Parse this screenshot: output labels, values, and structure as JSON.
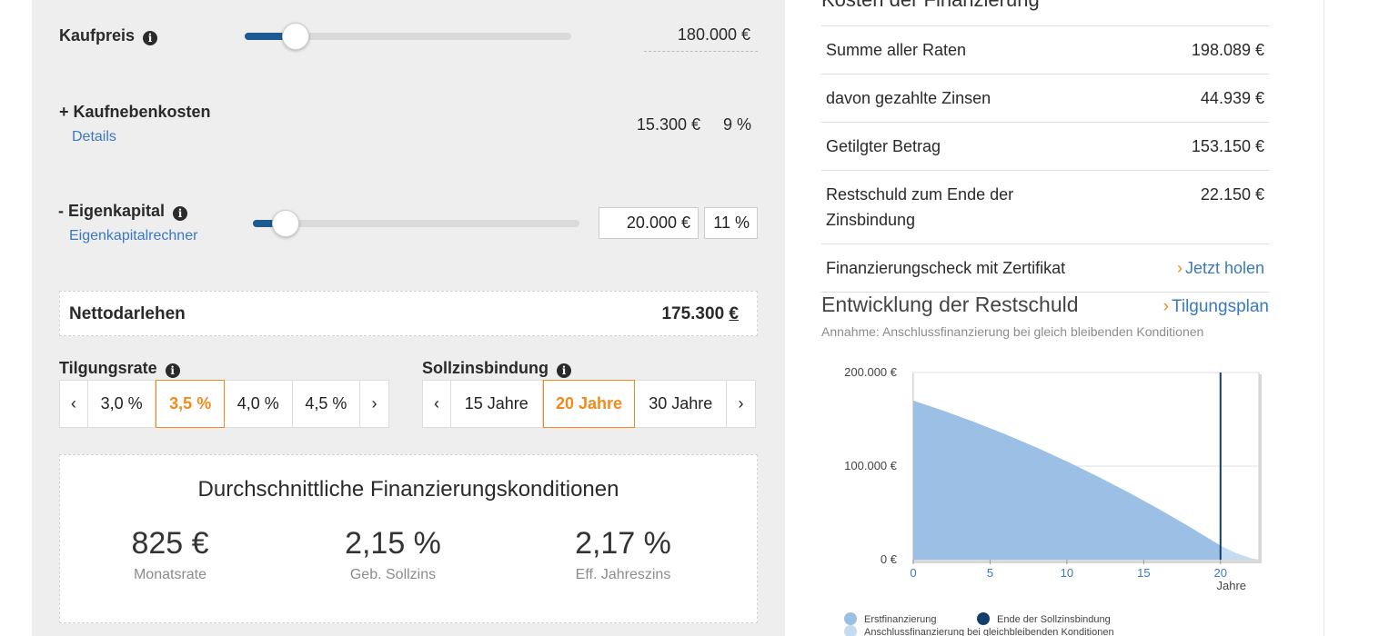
{
  "kaufpreis": {
    "label": "Kaufpreis",
    "value": "180.000 €",
    "slider_fraction": 0.155
  },
  "nebenkosten": {
    "label": "+ Kaufnebenkosten",
    "details_link": "Details",
    "amount": "15.300 €",
    "percent": "9 %"
  },
  "eigenkapital": {
    "label": "- Eigenkapital",
    "link": "Eigenkapitalrechner",
    "amount": "20.000 €",
    "percent": "11 %",
    "slider_fraction": 0.1
  },
  "netto": {
    "label": "Nettodarlehen",
    "value_num": "175.300",
    "value_unit": "€"
  },
  "tilgung": {
    "label": "Tilgungsrate",
    "prev": "‹",
    "next": "›",
    "options": [
      "3,0 %",
      "3,5 %",
      "4,0 %",
      "4,5 %"
    ],
    "selected": "3,5 %"
  },
  "sollzins": {
    "label": "Sollzinsbindung",
    "prev": "‹",
    "next": "›",
    "options": [
      "15 Jahre",
      "20 Jahre",
      "30 Jahre"
    ],
    "selected": "20 Jahre"
  },
  "conditions": {
    "title": "Durchschnittliche Finanzierungskonditionen",
    "monatsrate": {
      "value": "825 €",
      "label": "Monatsrate"
    },
    "sollzins": {
      "value": "2,15 %",
      "label": "Geb. Sollzins"
    },
    "jahreszins": {
      "value": "2,17 %",
      "label": "Eff. Jahreszins"
    }
  },
  "kosten": {
    "title": "Kosten der Finanzierung",
    "rows": [
      {
        "label": "Summe aller Raten",
        "value": "198.089 €"
      },
      {
        "label": "davon gezahlte Zinsen",
        "value": "44.939 €"
      },
      {
        "label": "Getilgter Betrag",
        "value": "153.150 €"
      },
      {
        "label": "Restschuld zum Ende der Zinsbindung",
        "value": "22.150 €"
      }
    ],
    "check_label": "Finanzierungscheck mit Zertifikat",
    "check_link": "Jetzt holen"
  },
  "chart_section": {
    "title": "Entwicklung der Restschuld",
    "link": "Tilgungsplan",
    "subtitle": "Annahme: Anschlussfinanzierung bei gleich bleibenden Konditionen"
  },
  "chart_data": {
    "type": "area",
    "xlabel": "Jahre",
    "ylabel": "",
    "xlim": [
      0,
      22.5
    ],
    "ylim": [
      0,
      200000
    ],
    "x_ticks": [
      "0",
      "5",
      "10",
      "15",
      "20"
    ],
    "y_ticks": [
      "200.000 €",
      "100.000 €",
      "0 €"
    ],
    "series": [
      {
        "name": "Erstfinanzierung",
        "x": [
          0,
          2,
          4,
          6,
          8,
          10,
          12,
          14,
          16,
          18,
          20
        ],
        "y": [
          170000,
          159000,
          147000,
          134000,
          120000,
          105000,
          89000,
          72000,
          54000,
          35000,
          15000
        ],
        "color": "#9bbfe5"
      },
      {
        "name": "Anschlussfinanzierung bei gleichbleibenden Konditionen",
        "x": [
          20,
          21,
          22,
          22.5
        ],
        "y": [
          15000,
          7000,
          1500,
          0
        ],
        "color": "#c5dbf1"
      }
    ],
    "marker": {
      "name": "Ende der Sollzinsbindung",
      "x": 20,
      "color": "#123e6e"
    },
    "grid": true,
    "legend_position": "bottom-left"
  }
}
